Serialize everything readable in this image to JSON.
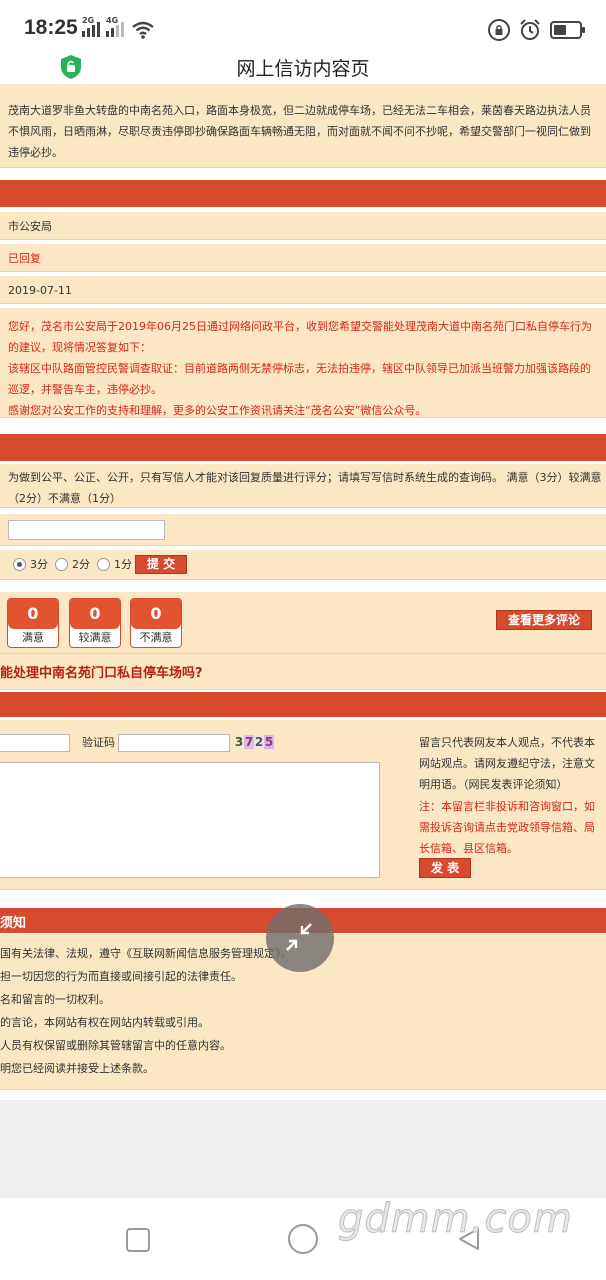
{
  "status_bar": {
    "time": "18:25",
    "sim1_label": "2G",
    "sim2_label": "4G"
  },
  "app": {
    "title": "网上信访内容页"
  },
  "letter": {
    "content": "茂南大道罗非鱼大转盘的中南名苑入口，路面本身极宽，但二边就成停车场，已经无法二车相会，莱茵春天路边执法人员不惧风雨，日晒雨淋，尽职尽责违停即抄确保路面车辆畅通无阻，而对面就不闻不问不抄呢，希望交警部门一视同仁做到违停必抄。"
  },
  "reply": {
    "department": "市公安局",
    "status": "已回复",
    "date": "2019-07-11",
    "line1": "您好，茂名市公安局于2019年06月25日通过网络问政平台，收到您希望交警能处理茂南大道中南名苑门口私自停车行为的建议，现将情况答复如下：",
    "line2": "该辖区中队路面管控民警调查取证：目前道路两侧无禁停标志，无法拍违停，辖区中队领导已加派当班警力加强该路段的巡逻，并警告车主，违停必抄。",
    "line3": "感谢您对公安工作的支持和理解，更多的公安工作资讯请关注“茂名公安”微信公众号。"
  },
  "rating": {
    "instructions": "为做到公平、公正、公开，只有写信人才能对该回复质量进行评分；请填写写信时系统生成的查询码。 满意（3分）较满意（2分）不满意（1分）",
    "input_value": "",
    "options": [
      "3分",
      "2分",
      "1分"
    ],
    "selected": "3分",
    "submit_label": "提 交"
  },
  "scores": [
    {
      "count": "0",
      "label": "满意"
    },
    {
      "count": "0",
      "label": "较满意"
    },
    {
      "count": "0",
      "label": "不满意"
    }
  ],
  "more_comments_label": "查看更多评论",
  "comment_section": {
    "topic_title": "能处理中南名苑门口私自停车场吗?",
    "captcha_label": "验证码",
    "captcha_chars": [
      "3",
      "7",
      "2",
      "5"
    ],
    "disclaimer": "留言只代表网友本人观点，不代表本网站观点。请网友遵纪守法，注意文明用语。（网民发表评论须知）",
    "notice": "注：本留言栏非投诉和咨询窗口，如需投诉咨询请点击党政领导信箱、局长信箱、县区信箱。",
    "post_label": "发 表"
  },
  "rules": {
    "header": "须知",
    "items": [
      "国有关法律、法规，遵守《互联网新闻信息服务管理规定》。",
      "担一切因您的行为而直接或间接引起的法律责任。",
      "名和留言的一切权利。",
      "的言论，本网站有权在网站内转载或引用。",
      "人员有权保留或删除其管辖留言中的任意内容。",
      "明您已经阅读并接受上述条款。"
    ]
  },
  "watermark": "gdmm.com",
  "colors": {
    "accent_red": "#d64a2e",
    "panel_bg": "#fbe7c4",
    "reply_text": "#d8261a"
  }
}
